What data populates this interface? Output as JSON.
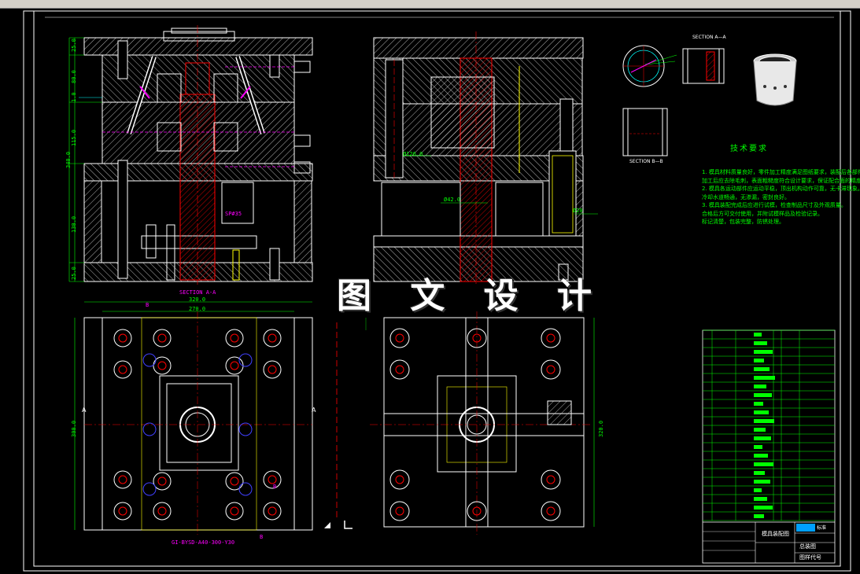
{
  "watermark": "图 文 设 计",
  "section_labels": {
    "section_aa": "SECTION A-A",
    "section_aa_detail": "SECTION A—A",
    "section_bb": "SECTION B—B"
  },
  "dimensions": {
    "h250_top": "25.0",
    "h800": "80.0",
    "h10": "1.0",
    "h1150": "115.0",
    "h3400": "340.0",
    "h1300": "130.0",
    "h250_bot": "25.0",
    "w3200": "320.0",
    "w2700": "270.0",
    "v3000_left": "300.0",
    "v3000_right": "320.0",
    "dia_42": "Ø42.0",
    "dia_20": "Ø20",
    "dia_126": "Ø126.0",
    "sp": "SP#35"
  },
  "view_marks": {
    "a_left": "A",
    "a_right": "A",
    "b_top": "B",
    "b_mid": "B",
    "b_bot": "B",
    "part_code": "GI-BYSD-A40-300-Y30"
  },
  "tech_requirements": {
    "title": "技术要求",
    "lines": [
      "1. 模具材料质量良好，零件加工精度满足图纸要求，装配后各部件动作灵活可靠。",
      "  加工后应去除毛刺，表面粗糙度符合设计要求，保证配合面的精度。",
      "2. 模具各运动部件应运动平稳，顶出机构动作可靠，无卡滞现象。",
      "  冷却水道畅通，无渗漏，密封良好。",
      "3. 模具装配完成后应进行试模，检查制品尺寸及外观质量。",
      "  合格后方可交付使用，并附试模样品及检验记录。",
      "  标记清楚，包装完整，防锈处理。"
    ]
  },
  "title_block": {
    "drawing_name": "模具装配图",
    "sheet_label": "总装图",
    "scale_label": "图样代号",
    "mark": "标准",
    "rows": 22
  },
  "colors": {
    "background": "#000000",
    "frame": "#ffffff",
    "outline": "#ffffff",
    "hatch": "#ff0000",
    "center": "#ff0000",
    "dimension": "#00ff00",
    "text_magenta": "#ff00ff",
    "cyan": "#00ffff",
    "yellow": "#ffff00",
    "blue": "#4040ff"
  }
}
